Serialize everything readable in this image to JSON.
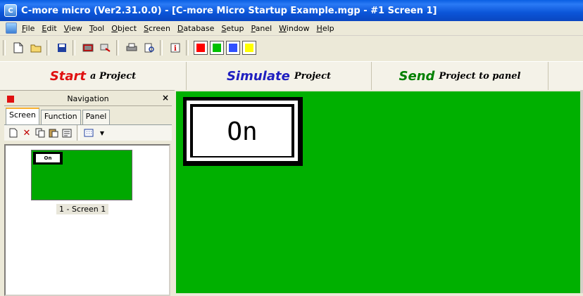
{
  "window": {
    "title": "C-more micro (Ver2.31.0.0) - [C-more Micro Startup Example.mgp - #1 Screen 1]",
    "icon": "app-icon"
  },
  "menu": [
    {
      "label": "File"
    },
    {
      "label": "Edit"
    },
    {
      "label": "View"
    },
    {
      "label": "Tool"
    },
    {
      "label": "Object"
    },
    {
      "label": "Screen"
    },
    {
      "label": "Database"
    },
    {
      "label": "Setup"
    },
    {
      "label": "Panel"
    },
    {
      "label": "Window"
    },
    {
      "label": "Help"
    }
  ],
  "toolbar": {
    "buttons": [
      "new-file-icon",
      "open-folder-icon",
      "save-icon",
      "screen-icon",
      "transfer-icon",
      "print-icon",
      "print-preview-icon",
      "info-icon"
    ],
    "colors": [
      "#FF0000",
      "#00C000",
      "#3050FF",
      "#FFFF00"
    ]
  },
  "banner": {
    "start": {
      "big": "Start",
      "small": "a Project",
      "color": "#E01010"
    },
    "simulate": {
      "big": "Simulate",
      "small": "Project",
      "color": "#2020C0"
    },
    "send": {
      "big": "Send",
      "small": "Project to panel",
      "color": "#008000"
    }
  },
  "navigation": {
    "title": "Navigation",
    "close": "×",
    "tabs": [
      {
        "label": "Screen",
        "active": true
      },
      {
        "label": "Function"
      },
      {
        "label": "Panel"
      }
    ],
    "screens": [
      {
        "label": "1 - Screen 1",
        "button_text": "On"
      }
    ]
  },
  "workspace": {
    "background": "#00B000",
    "button_text": "On"
  }
}
